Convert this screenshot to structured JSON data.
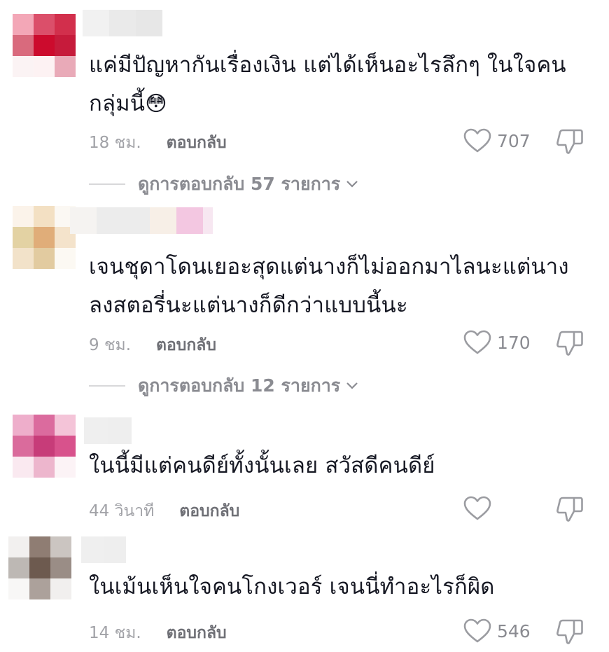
{
  "colors": {
    "text": "#161823",
    "meta": "#8a8b91",
    "icon": "#9b9ca1"
  },
  "comments": [
    {
      "avatar_pixels": [
        "#f3a7b7",
        "#db4f6a",
        "#d22f4c",
        "#d96a7d",
        "#cc0b2d",
        "#c61b3b",
        "#fbf3f4",
        "#fdf2f3",
        "#e9aab8"
      ],
      "username_pixels": [
        "#f1f1f1",
        "#eaeaea",
        "#e7e7e7"
      ],
      "text_lines": [
        "แค่มีปัญหากันเรื่องเงิน แต่ได้เห็นอะไรลึกๆ ในใจคน",
        "กลุ่มนี้"
      ],
      "emoji": "😳",
      "time": "18 ชม.",
      "reply_label": "ตอบกลับ",
      "likes": "707",
      "view_replies": "ดูการตอบกลับ 57 รายการ"
    },
    {
      "avatar_pixels": [
        "#fbf3ea",
        "#f3e0c3",
        "#fbf8f3",
        "#e3d2a3",
        "#e0ad79",
        "#f4e3cb",
        "#f2e2c9",
        "#e2cba0",
        "#fcf9f3"
      ],
      "username_pixels": [
        "#f5f3f1",
        "#ececec",
        "#ececec",
        "#f7efe7",
        "#f3c7e1",
        "#f7e7f1"
      ],
      "text_lines": [
        "เจนชุดาโดนเยอะสุดแต่นางก็ไม่ออกมาไลนะแต่นาง",
        "ลงสตอรี่นะแต่นางก็ดีกว่าแบบนี้นะ"
      ],
      "emoji": "",
      "time": "9 ชม.",
      "reply_label": "ตอบกลับ",
      "likes": "170",
      "view_replies": "ดูการตอบกลับ 12 รายการ"
    },
    {
      "avatar_pixels": [
        "#eeaecb",
        "#db6b9e",
        "#f4c4d8",
        "#da6b9c",
        "#c73c79",
        "#d8528c",
        "#fae9f0",
        "#edb6cd",
        "#fcf3f6"
      ],
      "username_pixels": [
        "#efefef",
        "#eeeeee"
      ],
      "text_lines": [
        "ในนี้มีแต่คนดีย์ทั้งนั้นเลย สวัสดีคนดีย์"
      ],
      "emoji": "",
      "time": "44 วินาที",
      "reply_label": "ตอบกลับ",
      "likes": "",
      "view_replies": ""
    },
    {
      "avatar_pixels": [
        "#f2f0ef",
        "#8f7d73",
        "#cbc5c1",
        "#bdb8b4",
        "#6d5a4f",
        "#9a8d86",
        "#f8f7f6",
        "#aca19b",
        "#f1efee"
      ],
      "username_pixels": [
        "#efefef",
        "#eeeeee"
      ],
      "text_lines": [
        "ในเม้นเห็นใจคนโกงเวอร์ เจนนี่ทำอะไรก็ผิด"
      ],
      "emoji": "",
      "time": "14 ชม.",
      "reply_label": "ตอบกลับ",
      "likes": "546",
      "view_replies": ""
    }
  ]
}
